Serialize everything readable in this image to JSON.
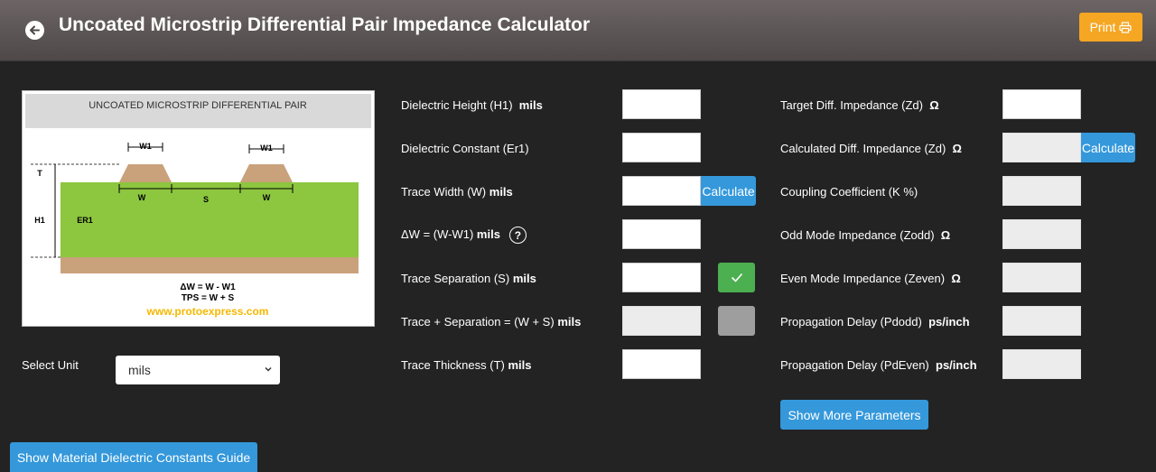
{
  "header": {
    "title": "Uncoated Microstrip Differential Pair Impedance Calculator",
    "print_label": "Print"
  },
  "diagram": {
    "heading": "UNCOATED MICROSTRIP DIFFERENTIAL PAIR",
    "labels": {
      "w1": "W1",
      "w": "W",
      "s": "S",
      "t": "T",
      "h1": "H1",
      "er1": "ER1"
    },
    "formula1": "ΔW = W - W1",
    "formula2": "TPS = W + S",
    "website": "www.protoexpress.com",
    "colors": {
      "dielectric": "#8dc63f",
      "copper": "#c9a27c",
      "header_bar": "#d9d9d9",
      "link": "#f5b800"
    }
  },
  "left_params": [
    {
      "label": "Dielectric Height (H1)",
      "unit": "mils",
      "value": ""
    },
    {
      "label": "Dielectric Constant (Er1)",
      "unit": "",
      "value": ""
    },
    {
      "label": "Trace Width (W)",
      "unit": "mils",
      "value": ""
    },
    {
      "label": "ΔW = (W-W1)",
      "unit": "mils",
      "value": ""
    },
    {
      "label": "Trace Separation (S)",
      "unit": "mils",
      "value": ""
    },
    {
      "label": "Trace + Separation = (W + S)",
      "unit": "mils",
      "value": ""
    },
    {
      "label": "Trace Thickness (T)",
      "unit": "mils",
      "value": ""
    }
  ],
  "right_params": [
    {
      "label": "Target Diff. Impedance (Zd)",
      "unit": "Ω",
      "value": ""
    },
    {
      "label": "Calculated Diff. Impedance (Zd)",
      "unit": "Ω",
      "value": ""
    },
    {
      "label": "Coupling Coefficient (K %)",
      "unit": "",
      "value": ""
    },
    {
      "label": "Odd Mode Impedance (Zodd)",
      "unit": "Ω",
      "value": ""
    },
    {
      "label": "Even Mode Impedance (Zeven)",
      "unit": "Ω",
      "value": ""
    },
    {
      "label": "Propagation Delay (Pdodd)",
      "unit": "ps/inch",
      "value": ""
    },
    {
      "label": "Propagation Delay (PdEven)",
      "unit": "ps/inch",
      "value": ""
    }
  ],
  "calculate_label": "Calculate",
  "help_symbol": "?",
  "unit_select": {
    "label": "Select Unit",
    "selected": "mils"
  },
  "show_more_label": "Show More Parameters",
  "material_guide_label": "Show Material Dielectric Constants Guide",
  "colors": {
    "accent_blue": "#3498db",
    "print_orange": "#f5a623",
    "check_green": "#4caf50"
  }
}
